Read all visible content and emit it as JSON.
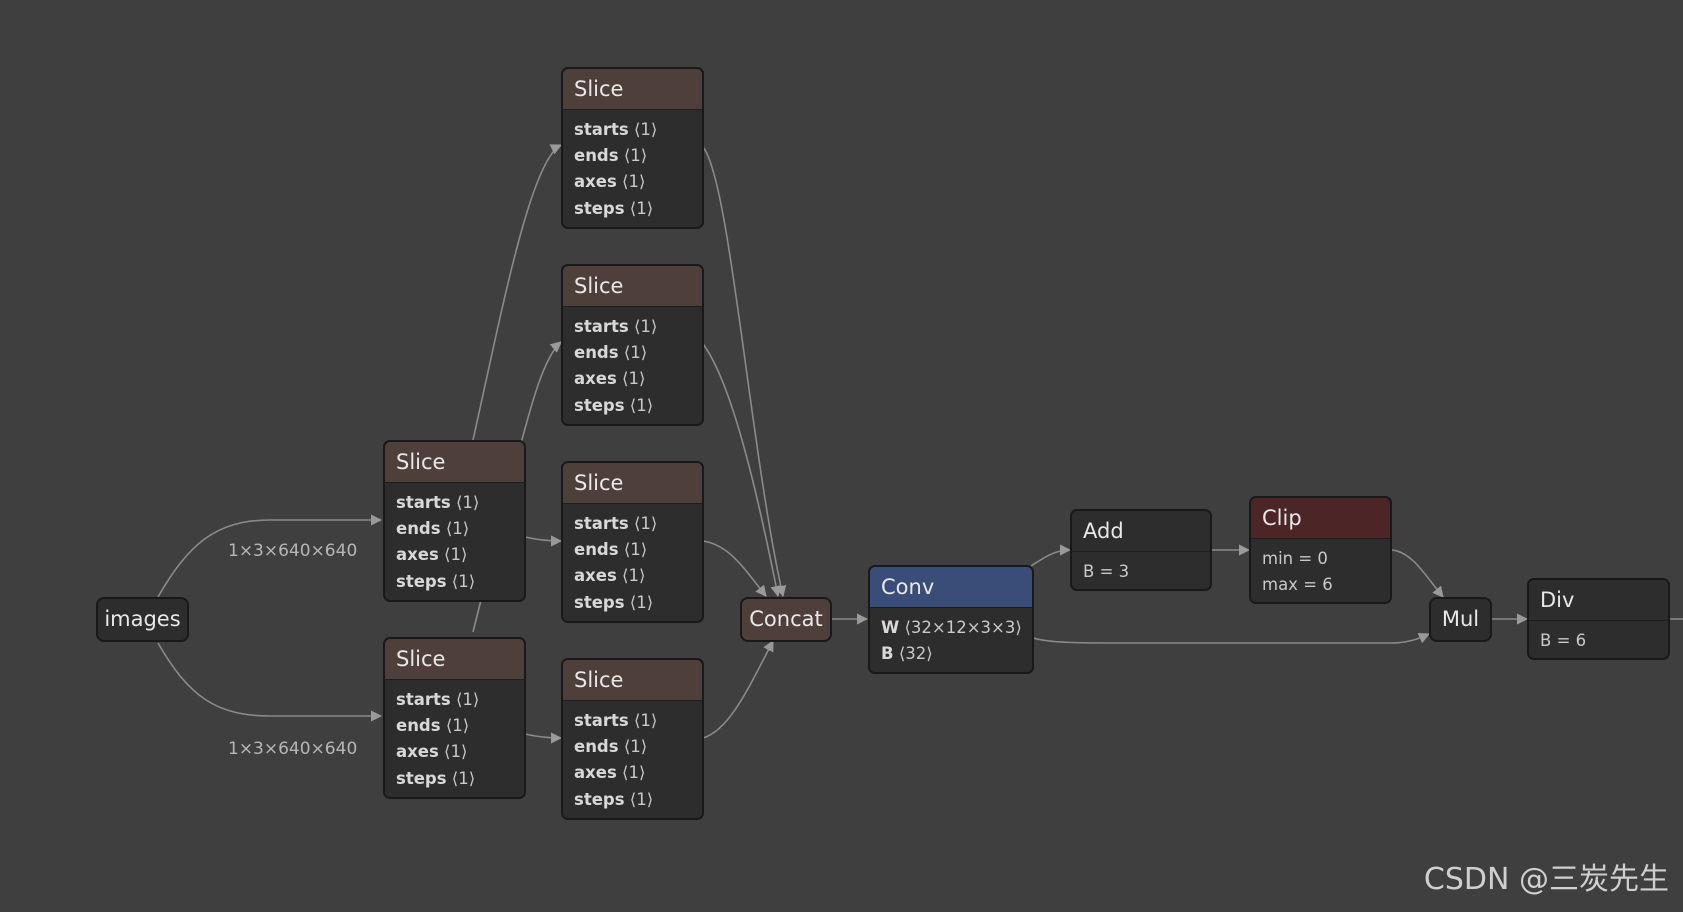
{
  "colors": {
    "background": "#3f3f3f",
    "node_body": "#2d2d2d",
    "slice_header": "#4f3f3b",
    "concat_header": "#4f3f3b",
    "conv_header": "#3a4c78",
    "clip_header": "#4c2626",
    "plain_header": "#2d2d2d",
    "edge": "#8a8a8a"
  },
  "input": {
    "label": "images"
  },
  "edge_labels": {
    "upper": "1×3×640×640",
    "lower": "1×3×640×640"
  },
  "slice_nodes": [
    {
      "title": "Slice",
      "attrs": [
        {
          "k": "starts",
          "v": "⟨1⟩"
        },
        {
          "k": "ends",
          "v": "⟨1⟩"
        },
        {
          "k": "axes",
          "v": "⟨1⟩"
        },
        {
          "k": "steps",
          "v": "⟨1⟩"
        }
      ]
    },
    {
      "title": "Slice",
      "attrs": [
        {
          "k": "starts",
          "v": "⟨1⟩"
        },
        {
          "k": "ends",
          "v": "⟨1⟩"
        },
        {
          "k": "axes",
          "v": "⟨1⟩"
        },
        {
          "k": "steps",
          "v": "⟨1⟩"
        }
      ]
    },
    {
      "title": "Slice",
      "attrs": [
        {
          "k": "starts",
          "v": "⟨1⟩"
        },
        {
          "k": "ends",
          "v": "⟨1⟩"
        },
        {
          "k": "axes",
          "v": "⟨1⟩"
        },
        {
          "k": "steps",
          "v": "⟨1⟩"
        }
      ]
    },
    {
      "title": "Slice",
      "attrs": [
        {
          "k": "starts",
          "v": "⟨1⟩"
        },
        {
          "k": "ends",
          "v": "⟨1⟩"
        },
        {
          "k": "axes",
          "v": "⟨1⟩"
        },
        {
          "k": "steps",
          "v": "⟨1⟩"
        }
      ]
    },
    {
      "title": "Slice",
      "attrs": [
        {
          "k": "starts",
          "v": "⟨1⟩"
        },
        {
          "k": "ends",
          "v": "⟨1⟩"
        },
        {
          "k": "axes",
          "v": "⟨1⟩"
        },
        {
          "k": "steps",
          "v": "⟨1⟩"
        }
      ]
    },
    {
      "title": "Slice",
      "attrs": [
        {
          "k": "starts",
          "v": "⟨1⟩"
        },
        {
          "k": "ends",
          "v": "⟨1⟩"
        },
        {
          "k": "axes",
          "v": "⟨1⟩"
        },
        {
          "k": "steps",
          "v": "⟨1⟩"
        }
      ]
    }
  ],
  "concat": {
    "label": "Concat"
  },
  "conv": {
    "title": "Conv",
    "attrs": [
      {
        "k": "W",
        "v": "⟨32×12×3×3⟩"
      },
      {
        "k": "B",
        "v": "⟨32⟩"
      }
    ]
  },
  "add": {
    "title": "Add",
    "attrs": [
      {
        "text": "B = 3"
      }
    ]
  },
  "clip": {
    "title": "Clip",
    "attrs": [
      {
        "text": "min = 0"
      },
      {
        "text": "max = 6"
      }
    ]
  },
  "mul": {
    "label": "Mul"
  },
  "div": {
    "title": "Div",
    "attrs": [
      {
        "text": "B = 6"
      }
    ]
  },
  "watermark": "CSDN @三炭先生"
}
